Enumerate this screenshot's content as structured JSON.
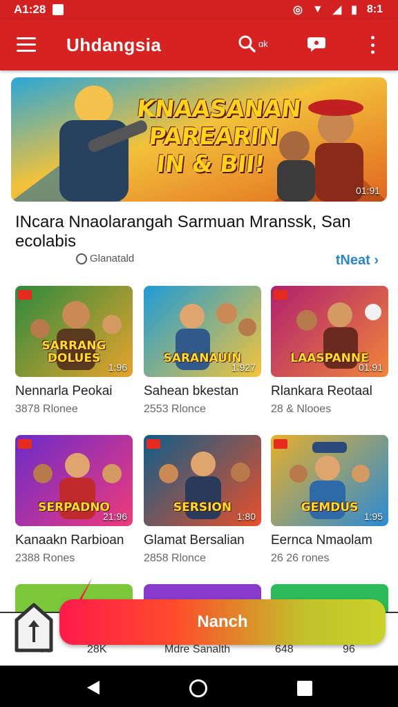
{
  "status_bar": {
    "time": "A1:28",
    "right_text": "8:1",
    "icons": [
      "notification-icon",
      "vibrate-icon",
      "wifi-icon",
      "signal-icon",
      "battery-icon"
    ]
  },
  "app_bar": {
    "title": "Uhdangsia",
    "search_label": "ɑk",
    "icons": [
      "menu-icon",
      "search-icon",
      "chat-icon",
      "more-icon"
    ]
  },
  "hero": {
    "banner_text": "KNAASANAN PAREARIN IN & BII!",
    "duration": "01:91"
  },
  "article": {
    "title": "INcara Nnaolarangah Sarmuan Mranssk, San ecolabis",
    "author": "Glanatald",
    "next_label": "tNeat ›"
  },
  "grid": [
    {
      "thumb_title": "SARRANG DOLUES",
      "duration": "1:96",
      "name": "Nennarla Peokai",
      "meta": "3878 Rlonee",
      "gradient": [
        "#2d8a3e",
        "#e8a32b"
      ]
    },
    {
      "thumb_title": "SARANAUIN",
      "duration": "1:927",
      "name": "Sahean bkestan",
      "meta": "2553 Rlonce",
      "gradient": [
        "#1e9bd6",
        "#f5c43a"
      ]
    },
    {
      "thumb_title": "LAASPANNE",
      "duration": "01:91",
      "name": "Rlankara Reotaal",
      "meta": "28 & Nlooes",
      "gradient": [
        "#b0206e",
        "#f0853a"
      ]
    },
    {
      "thumb_title": "SERPADNO",
      "duration": "21:96",
      "name": "Kanaakn Rarbioan",
      "meta": "2388 Rones",
      "gradient": [
        "#6c2bc9",
        "#f03a7a"
      ]
    },
    {
      "thumb_title": "SERSION",
      "duration": "1:80",
      "name": "Glamat Bersalian",
      "meta": "2858 Rlonce",
      "gradient": [
        "#0f5d8a",
        "#e8502a"
      ]
    },
    {
      "thumb_title": "GEMDUS",
      "duration": "1:95",
      "name": "Eernca Nmaolam",
      "meta": "26 26 rones",
      "gradient": [
        "#e8b02a",
        "#2a8ad6"
      ]
    }
  ],
  "bottom_peek": [
    {
      "color": "#7ac83a"
    },
    {
      "color": "#8a3acb"
    },
    {
      "color": "#2cba5a"
    }
  ],
  "bottom_nav": {
    "labels": [
      "A",
      "28K",
      "Mdre Sanalth",
      "648",
      "96"
    ]
  },
  "cta": {
    "label": "Nanch"
  },
  "colors": {
    "primary": "#d72222",
    "link": "#2a86c9"
  }
}
